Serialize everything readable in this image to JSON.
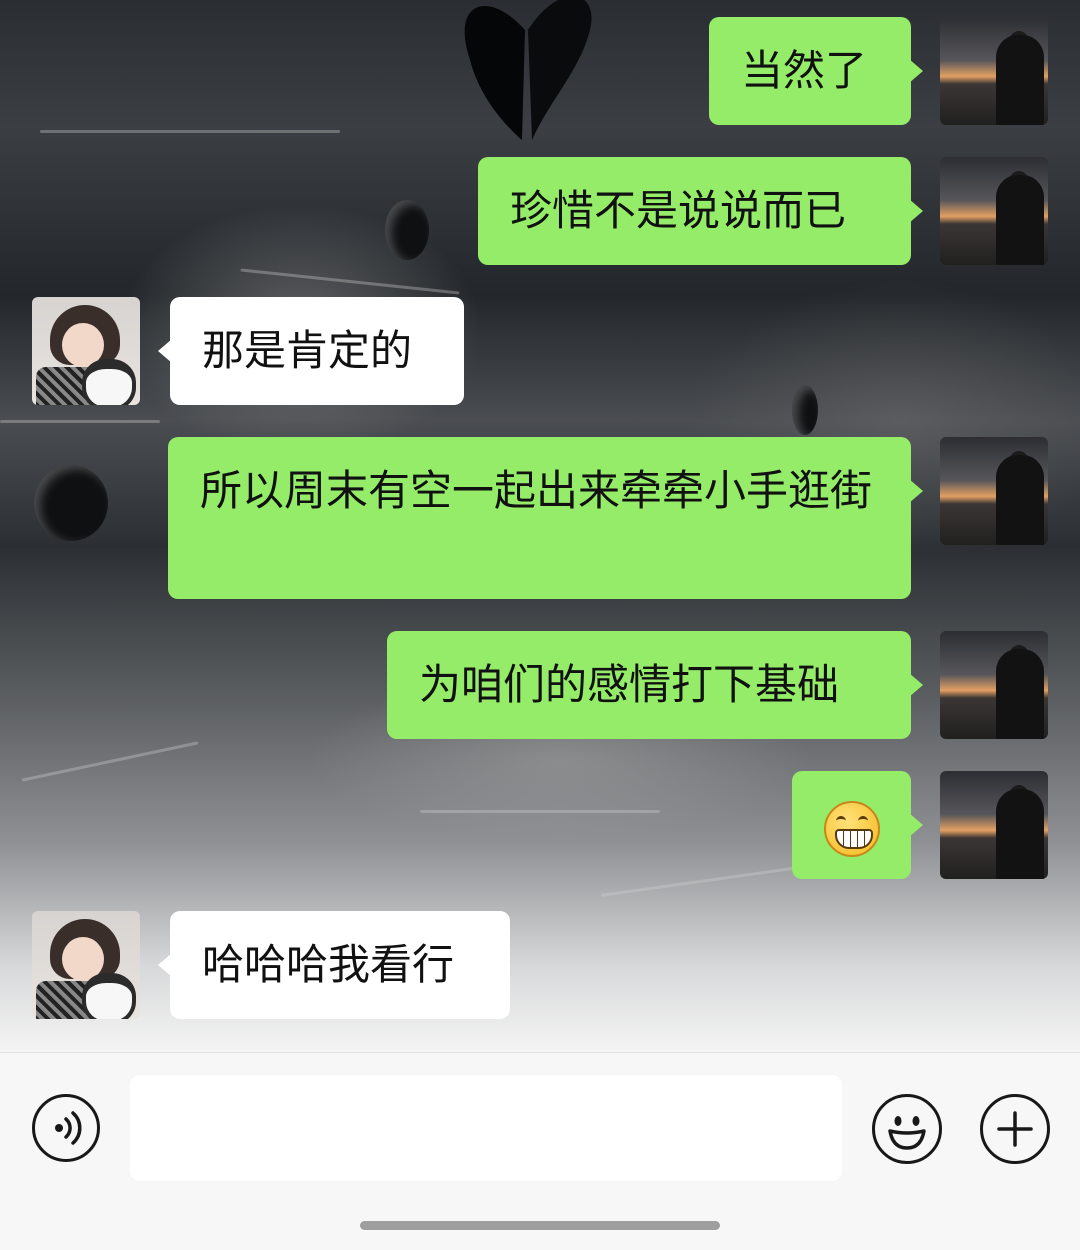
{
  "colors": {
    "outgoing_bubble": "#95ec69",
    "incoming_bubble": "#ffffff",
    "input_bar_bg": "#f7f7f7"
  },
  "messages": [
    {
      "from": "me",
      "text": "当然了"
    },
    {
      "from": "me",
      "text": "珍惜不是说说而已"
    },
    {
      "from": "other",
      "text": "那是肯定的"
    },
    {
      "from": "me",
      "text": "所以周末有空一起出来牵牵小手逛街"
    },
    {
      "from": "me",
      "text": "为咱们的感情打下基础"
    },
    {
      "from": "me",
      "text": "",
      "emoji": "grin-emoji"
    },
    {
      "from": "other",
      "text": "哈哈哈我看行"
    }
  ],
  "input_bar": {
    "voice_icon": "voice-icon",
    "message_value": "",
    "emoji_icon": "smiley-icon",
    "more_icon": "plus-icon"
  }
}
